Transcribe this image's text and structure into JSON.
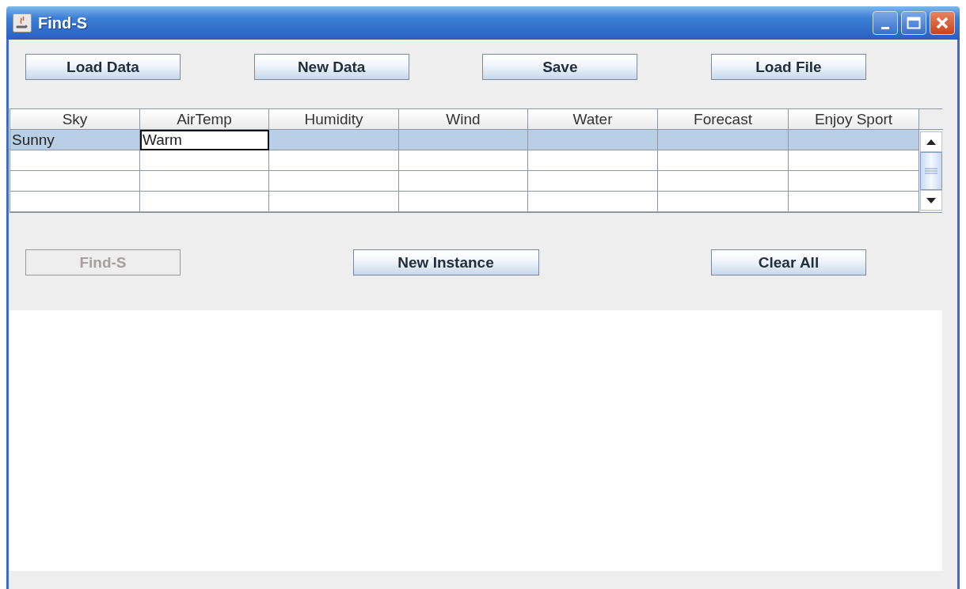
{
  "window": {
    "title": "Find-S"
  },
  "top_buttons": [
    {
      "label": "Load Data",
      "disabled": false
    },
    {
      "label": "New Data",
      "disabled": false
    },
    {
      "label": "Save",
      "disabled": false
    },
    {
      "label": "Load File",
      "disabled": false
    }
  ],
  "table": {
    "columns": [
      "Sky",
      "AirTemp",
      "Humidity",
      "Wind",
      "Water",
      "Forecast",
      "Enjoy Sport"
    ],
    "rows": [
      {
        "selected": true,
        "cells": [
          {
            "text": "Sunny",
            "editing": false
          },
          {
            "text": "Warm",
            "editing": true
          }
        ]
      },
      {
        "selected": false,
        "cells": []
      },
      {
        "selected": false,
        "cells": []
      },
      {
        "selected": false,
        "cells": []
      }
    ]
  },
  "bottom_buttons": [
    {
      "label": "Find-S",
      "disabled": true
    },
    {
      "label": "New Instance",
      "disabled": false
    },
    {
      "label": "Clear All",
      "disabled": false
    }
  ]
}
